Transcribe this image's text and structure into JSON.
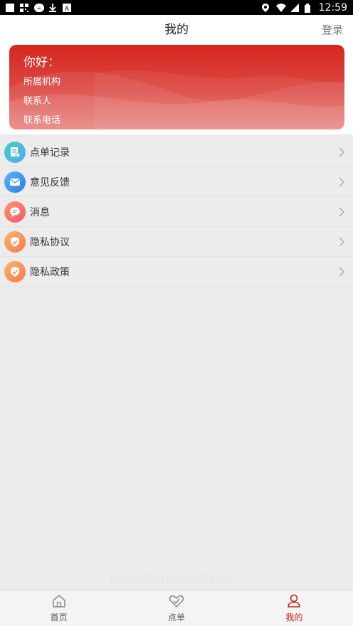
{
  "status_bar": {
    "time": "12:59"
  },
  "header": {
    "title": "我的",
    "login_label": "登录"
  },
  "profile_card": {
    "greeting": "你好：",
    "organization_label": "所属机构",
    "contact_label": "联系人",
    "phone_label": "联系电话"
  },
  "menu": {
    "items": [
      {
        "label": "点单记录",
        "icon": "order-record-icon"
      },
      {
        "label": "意见反馈",
        "icon": "feedback-icon"
      },
      {
        "label": "消息",
        "icon": "message-icon"
      },
      {
        "label": "隐私协议",
        "icon": "privacy-agreement-icon"
      },
      {
        "label": "隐私政策",
        "icon": "privacy-policy-icon"
      }
    ]
  },
  "watermark": "忻州市新时代文明实践中心",
  "bottom_nav": {
    "items": [
      {
        "label": "首页",
        "icon": "home-icon"
      },
      {
        "label": "点单",
        "icon": "order-icon"
      },
      {
        "label": "我的",
        "icon": "user-icon",
        "active": true
      }
    ]
  },
  "colors": {
    "accent": "#c8201a",
    "card_top": "#d6261f",
    "card_bottom": "#e57a76"
  }
}
